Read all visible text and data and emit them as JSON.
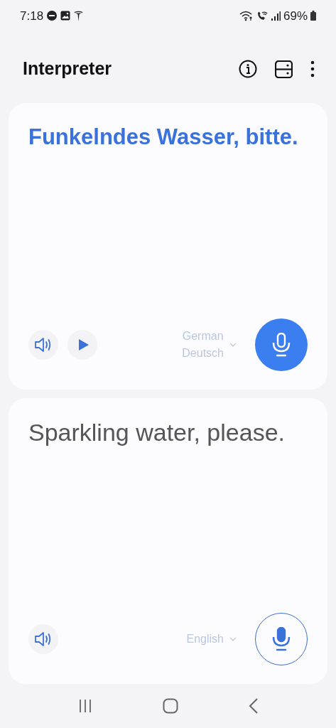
{
  "status_bar": {
    "time": "7:18",
    "battery": "69%"
  },
  "header": {
    "title": "Interpreter"
  },
  "panels": [
    {
      "kind": "source",
      "text": "Funkelndes Wasser, bitte.",
      "controls": [
        {
          "kind": "speaker"
        },
        {
          "kind": "play"
        }
      ],
      "language": "German",
      "language_native": "Deutsch",
      "mic_active": true
    },
    {
      "kind": "target",
      "text": "Sparkling water, please.",
      "controls": [
        {
          "kind": "speaker"
        }
      ],
      "language": "English",
      "mic_active": false
    }
  ]
}
